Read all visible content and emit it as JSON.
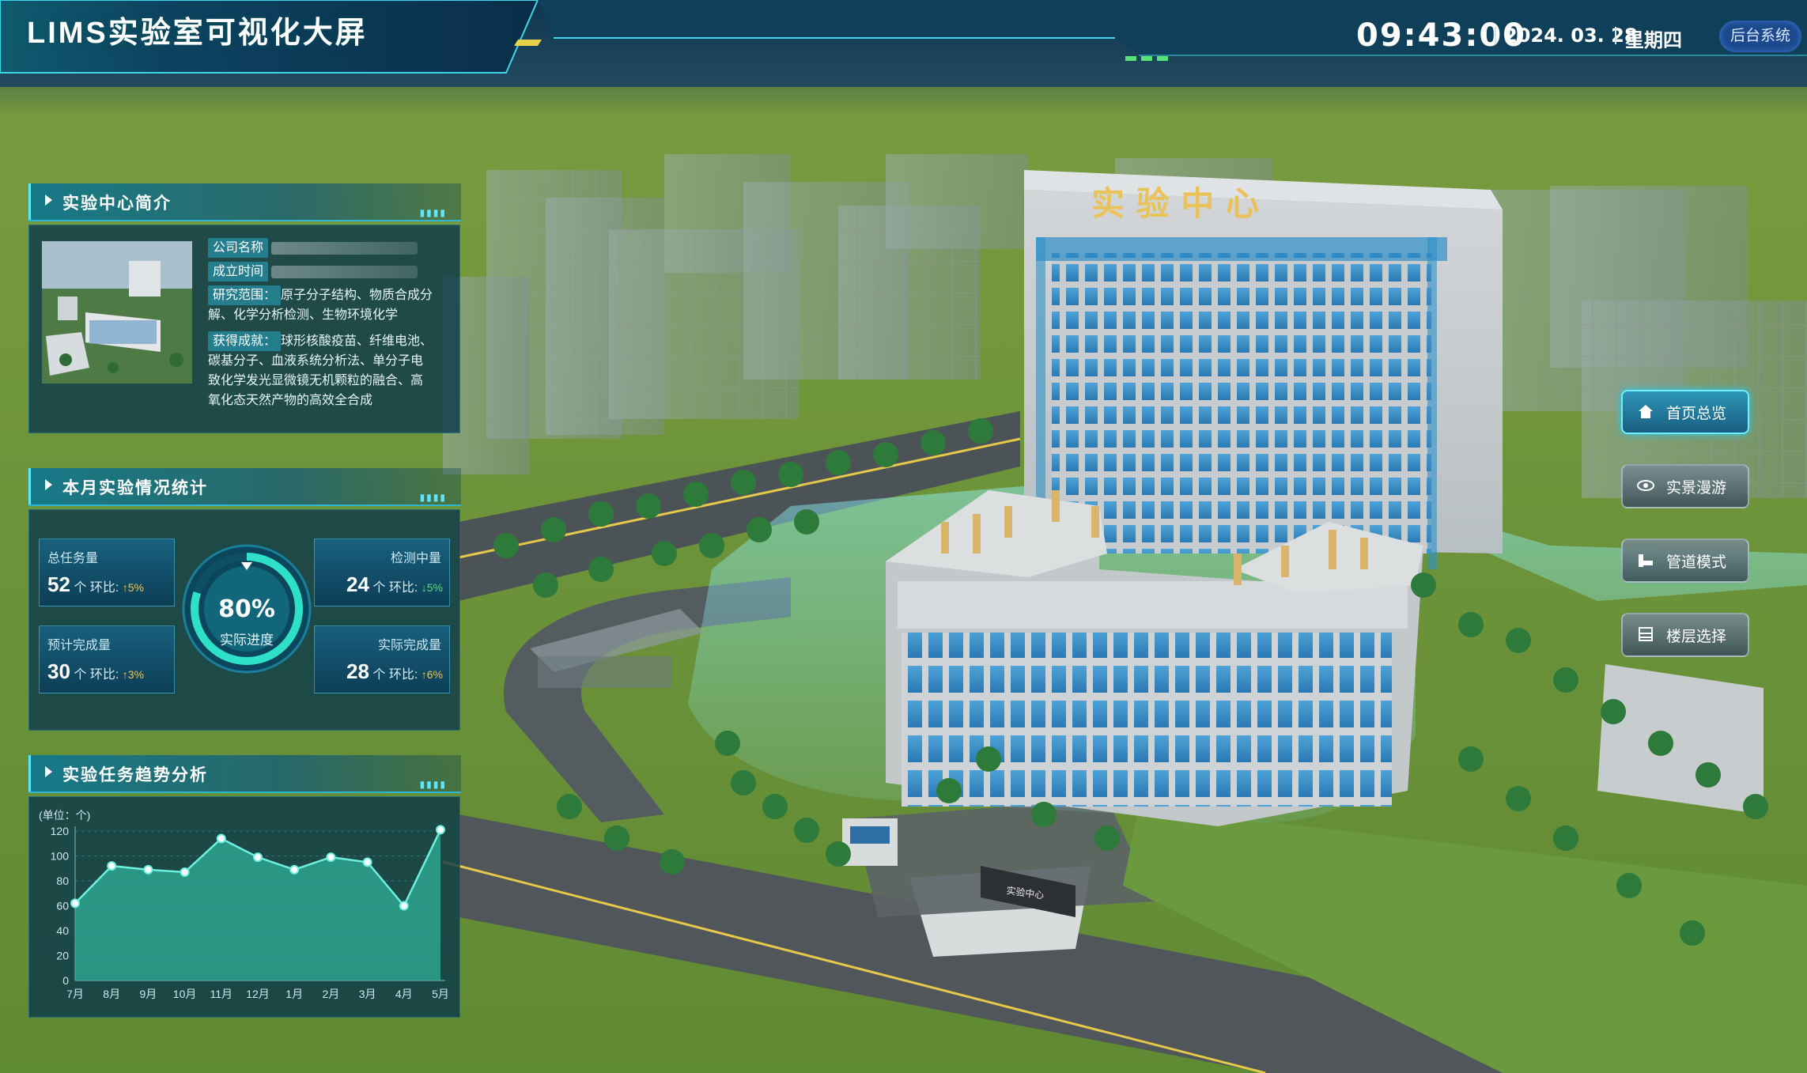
{
  "header": {
    "title": "LIMS实验室可视化大屏",
    "time": "09:43:00",
    "date": "2024. 03. 28",
    "weekday": "星期四",
    "backend_button": "后台系统"
  },
  "intro_panel": {
    "title": "实验中心简介",
    "company_label": "公司名称",
    "founded_label": "成立时间",
    "research_label": "研究范围：",
    "research_text_1": "原子分子结构、物质合成分",
    "research_text_2": "解、化学分析检测、生物环境化学",
    "achievement_label": "获得成就：",
    "achievement_text_1": "球形核酸疫苗、纤维电池、",
    "achievement_text_2": "碳基分子、血液系统分析法、单分子电",
    "achievement_text_3": "致化学发光显微镜无机颗粒的融合、高",
    "achievement_text_4": "氧化态天然产物的高效全合成"
  },
  "stats_panel": {
    "title": "本月实验情况统计",
    "total": {
      "label": "总任务量",
      "value": "52",
      "unit": "个",
      "ratio_label": "环比:",
      "ratio": "↑5%"
    },
    "testing": {
      "label": "检测中量",
      "value": "24",
      "unit": "个",
      "ratio_label": "环比:",
      "ratio": "↓5%"
    },
    "planned": {
      "label": "预计完成量",
      "value": "30",
      "unit": "个",
      "ratio_label": "环比:",
      "ratio": "↑3%"
    },
    "actual": {
      "label": "实际完成量",
      "value": "28",
      "unit": "个",
      "ratio_label": "环比:",
      "ratio": "↑6%"
    },
    "progress": {
      "value": "80%",
      "fraction": 0.8,
      "label": "实际进度"
    }
  },
  "trend_panel": {
    "title": "实验任务趋势分析",
    "unit_label": "(单位：个)"
  },
  "chart_data": {
    "type": "area",
    "title": "",
    "ylabel": "(单位：个)",
    "ylim": [
      0,
      120
    ],
    "yticks": [
      0,
      20,
      40,
      60,
      80,
      100,
      120
    ],
    "categories": [
      "7月",
      "8月",
      "9月",
      "10月",
      "11月",
      "12月",
      "1月",
      "2月",
      "3月",
      "4月",
      "5月"
    ],
    "values": [
      62,
      92,
      89,
      87,
      114,
      99,
      89,
      99,
      95,
      60,
      121
    ],
    "x_values": [
      0,
      1,
      2,
      3,
      4,
      5,
      6,
      7,
      8,
      9,
      10
    ],
    "x_ticks": [
      0,
      1,
      2,
      3,
      4,
      5,
      6,
      7,
      8,
      9,
      10
    ]
  },
  "side_buttons": [
    {
      "label": "首页总览",
      "icon": "home-icon",
      "active": true
    },
    {
      "label": "实景漫游",
      "icon": "eye-icon",
      "active": false
    },
    {
      "label": "管道模式",
      "icon": "pipe-icon",
      "active": false
    },
    {
      "label": "楼层选择",
      "icon": "floor-icon",
      "active": false
    }
  ],
  "building": {
    "sign": "实 验 中 心",
    "gate_sign": "实验中心"
  },
  "colors": {
    "accent": "#5de6ff",
    "chart_line": "#6ef0e0",
    "chart_fill": "#2fb09a",
    "up": "#f5c64a",
    "down": "#58e07a"
  }
}
